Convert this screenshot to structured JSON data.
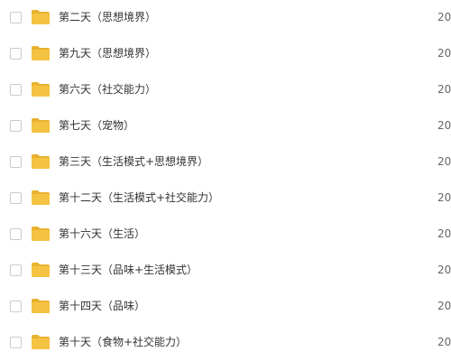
{
  "file_list": {
    "items": [
      {
        "name": "第二天（思想境界）",
        "date": "20"
      },
      {
        "name": "第九天（思想境界）",
        "date": "20"
      },
      {
        "name": "第六天（社交能力）",
        "date": "20"
      },
      {
        "name": "第七天（宠物）",
        "date": "20"
      },
      {
        "name": "第三天（生活模式+思想境界）",
        "date": "20"
      },
      {
        "name": "第十二天（生活模式+社交能力）",
        "date": "20"
      },
      {
        "name": "第十六天（生活）",
        "date": "20"
      },
      {
        "name": "第十三天（品味+生活模式）",
        "date": "20"
      },
      {
        "name": "第十四天（品味）",
        "date": "20"
      },
      {
        "name": "第十天（食物+社交能力）",
        "date": "20"
      }
    ]
  },
  "colors": {
    "folder": "#f5c342",
    "folder_tab": "#e9b22e",
    "checkbox_border": "#c8ccd3",
    "name_text": "#333333",
    "date_text": "#666666"
  },
  "icons": {
    "folder": "folder-icon",
    "checkbox": "checkbox"
  }
}
